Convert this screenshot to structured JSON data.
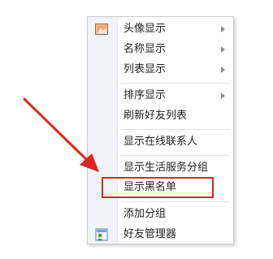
{
  "context_menu": {
    "items": [
      {
        "label": "头像显示",
        "submenu": true,
        "icon": "avatar-image-icon"
      },
      {
        "label": "名称显示",
        "submenu": true
      },
      {
        "label": "列表显示",
        "submenu": true
      },
      {
        "label": "排序显示",
        "submenu": true
      },
      {
        "label": "刷新好友列表"
      },
      {
        "label": "显示在线联系人"
      },
      {
        "label": "显示生活服务分组"
      },
      {
        "label": "显示黑名单",
        "highlighted": true
      },
      {
        "label": "添加分组"
      },
      {
        "label": "好友管理器",
        "icon": "friend-manager-icon"
      }
    ]
  },
  "annotation": {
    "color": "#d9281f"
  }
}
